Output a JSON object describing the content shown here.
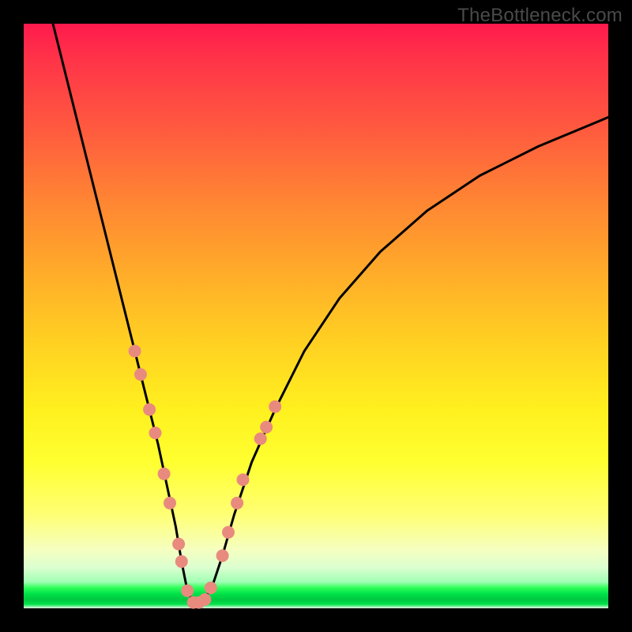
{
  "watermark": "TheBottleneck.com",
  "chart_data": {
    "type": "line",
    "title": "",
    "xlabel": "",
    "ylabel": "",
    "xlim": [
      0,
      100
    ],
    "ylim": [
      0,
      100
    ],
    "grid": false,
    "series": [
      {
        "name": "bottleneck-curve",
        "color": "#000000",
        "x": [
          5,
          8,
          11,
          14,
          17,
          19,
          21,
          23,
          24.5,
          26,
          27,
          28,
          29,
          30,
          32,
          34,
          36,
          39,
          43,
          48,
          54,
          61,
          69,
          78,
          88,
          100
        ],
        "y": [
          100,
          88,
          76,
          64,
          52,
          44,
          36,
          28,
          21,
          14,
          8,
          3,
          1,
          1,
          3,
          9,
          16,
          25,
          34,
          44,
          53,
          61,
          68,
          74,
          79,
          84
        ]
      }
    ],
    "markers": {
      "name": "highlight-dots",
      "color": "#e98a7f",
      "radius_px": 8,
      "points_xy": [
        [
          19.0,
          44
        ],
        [
          20.0,
          40
        ],
        [
          21.5,
          34
        ],
        [
          22.5,
          30
        ],
        [
          24.0,
          23
        ],
        [
          25.0,
          18
        ],
        [
          26.5,
          11
        ],
        [
          27.0,
          8
        ],
        [
          28.0,
          3
        ],
        [
          29.0,
          1
        ],
        [
          30.0,
          1
        ],
        [
          31.0,
          1.5
        ],
        [
          32.0,
          3.5
        ],
        [
          34.0,
          9
        ],
        [
          35.0,
          13
        ],
        [
          36.5,
          18
        ],
        [
          37.5,
          22
        ],
        [
          40.5,
          29
        ],
        [
          41.5,
          31
        ],
        [
          43.0,
          34.5
        ]
      ]
    }
  }
}
